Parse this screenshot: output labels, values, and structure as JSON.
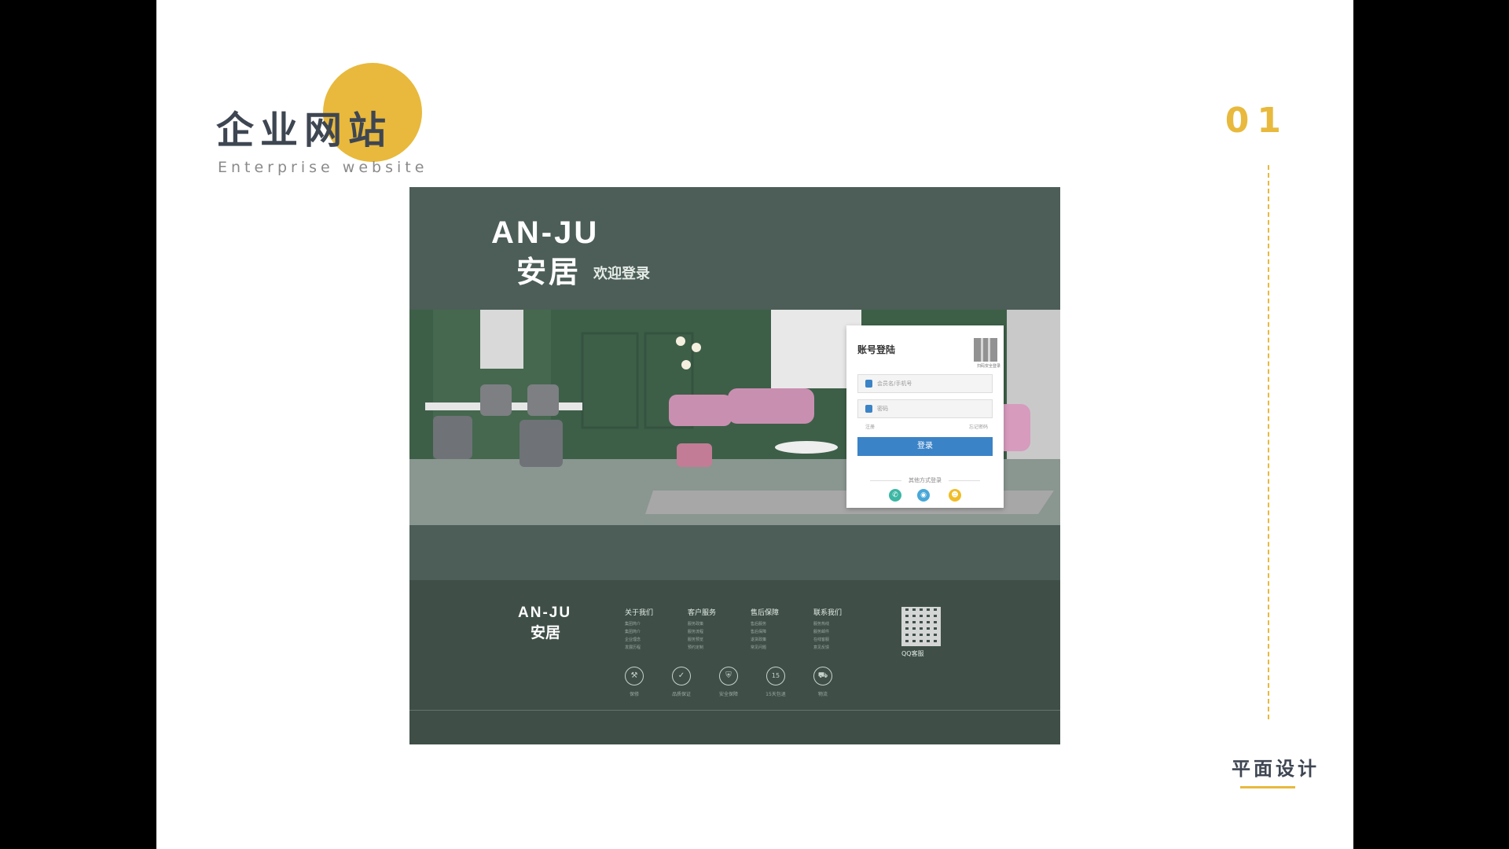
{
  "slide": {
    "title_cn": "企业网站",
    "title_en": "Enterprise website",
    "page_number": "01",
    "footer_label": "平面设计"
  },
  "colors": {
    "accent": "#e8b93c",
    "mock_bg": "#4c5e57",
    "login_btn": "#3b83c7"
  },
  "mockup": {
    "brand_en": "AN-JU",
    "brand_cn": "安居",
    "welcome": "欢迎登录",
    "login": {
      "title": "账号登陆",
      "qr_caption": "扫码安全登录",
      "username_placeholder": "会员名/手机号",
      "password_placeholder": "密码",
      "register": "注册",
      "forgot": "忘记密码",
      "submit": "登录",
      "other_methods": "其他方式登录",
      "social": [
        {
          "icon": "wechat-icon"
        },
        {
          "icon": "weibo-icon"
        },
        {
          "icon": "qq-icon"
        }
      ]
    },
    "footer": {
      "brand_en": "AN-JU",
      "brand_cn": "安居",
      "columns": [
        {
          "title": "关于我们",
          "items": [
            "集团简介",
            "集团简介",
            "企业理念",
            "发展历程",
            "联系"
          ]
        },
        {
          "title": "客户服务",
          "items": [
            "服务政策",
            "服务流程",
            "服务预览",
            "预约定制"
          ]
        },
        {
          "title": "售后保障",
          "items": [
            "售后服务",
            "售后保障",
            "退货政策",
            "常见问题"
          ]
        },
        {
          "title": "联系我们",
          "items": [
            "服务热线",
            "服务邮件",
            "在线客服",
            "意见反馈"
          ]
        }
      ],
      "qr_label": "QQ客服",
      "service_icons": [
        {
          "icon": "wrench-icon",
          "glyph": "⚒",
          "label": "保修"
        },
        {
          "icon": "check-icon",
          "glyph": "✓",
          "label": "品质保证"
        },
        {
          "icon": "lock-icon",
          "glyph": "⛨",
          "label": "安全保障"
        },
        {
          "icon": "fifteen-days-icon",
          "glyph": "15",
          "label": "15天包退"
        },
        {
          "icon": "truck-icon",
          "glyph": "⛟",
          "label": "物流"
        }
      ]
    }
  }
}
